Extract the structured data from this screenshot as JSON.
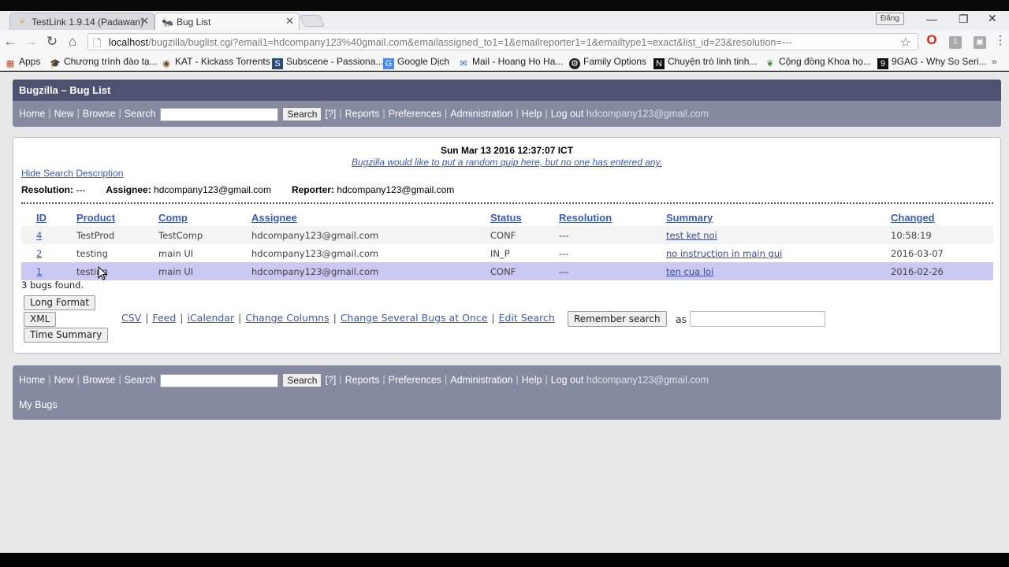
{
  "browser": {
    "tabs": [
      {
        "title": "TestLink 1.9.14 (Padawan)",
        "icon": "testlink-icon"
      },
      {
        "title": "Bug List",
        "icon": "bugzilla-icon"
      }
    ],
    "signin_label": "Đăng",
    "url_host": "localhost",
    "url_path": "/bugzilla/buglist.cgi?email1=hdcompany123%40gmail.com&emailassigned_to1=1&emailreporter1=1&emailtype1=exact&list_id=23&resolution=---",
    "bookmarks": [
      {
        "label": "Apps",
        "icon": "apps-grid-icon"
      },
      {
        "label": "Chương trình đào tạ...",
        "icon": "edu-icon"
      },
      {
        "label": "KAT - Kickass Torrents",
        "icon": "kat-icon"
      },
      {
        "label": "Subscene - Passiona...",
        "icon": "subscene-icon"
      },
      {
        "label": "Google Dịch",
        "icon": "translate-icon"
      },
      {
        "label": "Mail - Hoang Ho Ha...",
        "icon": "mail-icon"
      },
      {
        "label": "Family Options",
        "icon": "steam-icon"
      },
      {
        "label": "Chuyện trò linh tinh...",
        "icon": "chat-icon"
      },
      {
        "label": "Cộng đồng Khoa họ...",
        "icon": "science-icon"
      },
      {
        "label": "9GAG - Why So Seri...",
        "icon": "9gag-icon"
      }
    ]
  },
  "bugzilla": {
    "title": "Bugzilla – Bug List",
    "nav": {
      "home": "Home",
      "new": "New",
      "browse": "Browse",
      "search": "Search",
      "search_button": "Search",
      "help_q": "[?]",
      "reports": "Reports",
      "preferences": "Preferences",
      "administration": "Administration",
      "help": "Help",
      "logout": "Log out",
      "user_email": "hdcompany123@gmail.com"
    },
    "footer": {
      "my_bugs": "My Bugs"
    },
    "timestamp": "Sun Mar 13 2016 12:37:07 ICT",
    "quip": "Bugzilla would like to put a random quip here, but no one has entered any.",
    "hide_search_description": "Hide Search Description",
    "criteria": {
      "resolution_label": "Resolution:",
      "resolution_value": "---",
      "assignee_label": "Assignee:",
      "assignee_value": "hdcompany123@gmail.com",
      "reporter_label": "Reporter:",
      "reporter_value": "hdcompany123@gmail.com"
    },
    "columns": [
      "ID",
      "Product",
      "Comp",
      "Assignee",
      "Status",
      "Resolution",
      "Summary",
      "Changed"
    ],
    "bugs": [
      {
        "id": "4",
        "product": "TestProd",
        "comp": "TestComp",
        "assignee": "hdcompany123@gmail.com",
        "status": "CONF",
        "resolution": "---",
        "summary": "test ket noi",
        "changed": "10:58:19"
      },
      {
        "id": "2",
        "product": "testing",
        "comp": "main UI",
        "assignee": "hdcompany123@gmail.com",
        "status": "IN_P",
        "resolution": "---",
        "summary": "no instruction in main gui",
        "changed": "2016-03-07"
      },
      {
        "id": "1",
        "product": "testing",
        "comp": "main UI",
        "assignee": "hdcompany123@gmail.com",
        "status": "CONF",
        "resolution": "---",
        "summary": "ten cua loi",
        "changed": "2016-02-26"
      }
    ],
    "bug_count": "3 bugs found.",
    "buttons": {
      "long_format": "Long Format",
      "xml": "XML",
      "time_summary": "Time Summary",
      "remember_search": "Remember search"
    },
    "action_links": {
      "csv": "CSV",
      "feed": "Feed",
      "icalendar": "iCalendar",
      "change_columns": "Change Columns",
      "change_several": "Change Several Bugs at Once",
      "edit_search": "Edit Search"
    },
    "as_label": "as"
  }
}
